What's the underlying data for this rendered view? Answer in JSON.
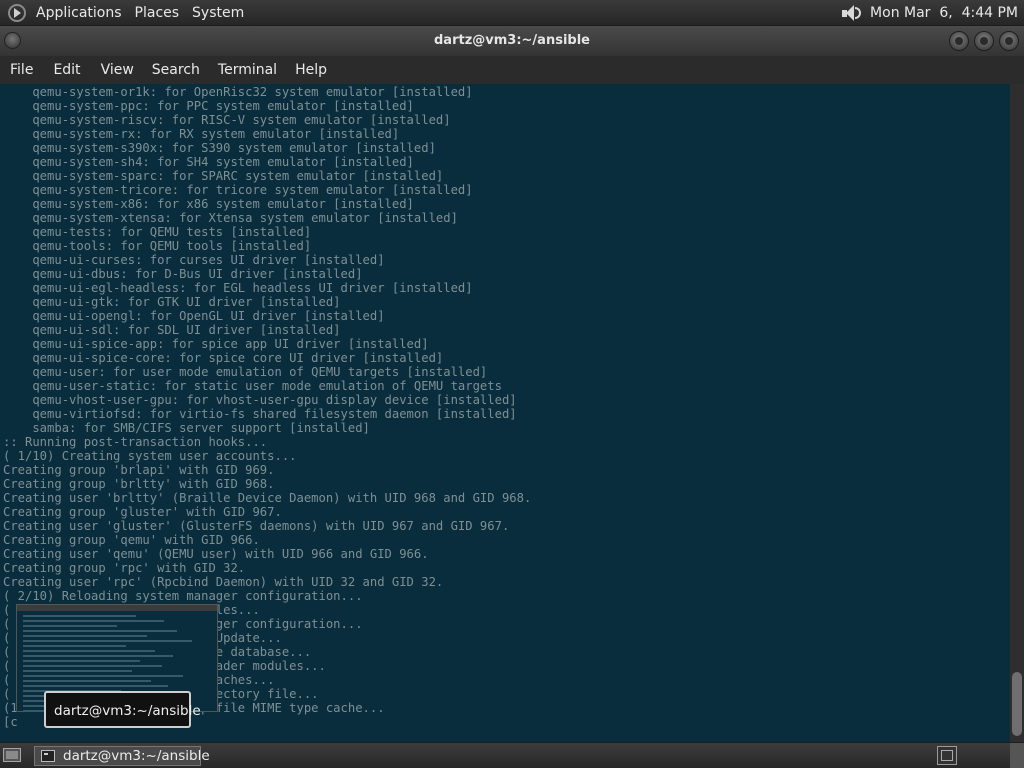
{
  "top_panel": {
    "applications": "Applications",
    "places": "Places",
    "system": "System",
    "clock": "Mon Mar  6,  4:44 PM"
  },
  "window": {
    "title": "dartz@vm3:~/ansible"
  },
  "menubar": {
    "file": "File",
    "edit": "Edit",
    "view": "View",
    "search": "Search",
    "terminal": "Terminal",
    "help": "Help"
  },
  "terminal": {
    "lines": [
      "    qemu-system-or1k: for OpenRisc32 system emulator [installed]",
      "    qemu-system-ppc: for PPC system emulator [installed]",
      "    qemu-system-riscv: for RISC-V system emulator [installed]",
      "    qemu-system-rx: for RX system emulator [installed]",
      "    qemu-system-s390x: for S390 system emulator [installed]",
      "    qemu-system-sh4: for SH4 system emulator [installed]",
      "    qemu-system-sparc: for SPARC system emulator [installed]",
      "    qemu-system-tricore: for tricore system emulator [installed]",
      "    qemu-system-x86: for x86 system emulator [installed]",
      "    qemu-system-xtensa: for Xtensa system emulator [installed]",
      "    qemu-tests: for QEMU tests [installed]",
      "    qemu-tools: for QEMU tools [installed]",
      "    qemu-ui-curses: for curses UI driver [installed]",
      "    qemu-ui-dbus: for D-Bus UI driver [installed]",
      "    qemu-ui-egl-headless: for EGL headless UI driver [installed]",
      "    qemu-ui-gtk: for GTK UI driver [installed]",
      "    qemu-ui-opengl: for OpenGL UI driver [installed]",
      "    qemu-ui-sdl: for SDL UI driver [installed]",
      "    qemu-ui-spice-app: for spice app UI driver [installed]",
      "    qemu-ui-spice-core: for spice core UI driver [installed]",
      "    qemu-user: for user mode emulation of QEMU targets [installed]",
      "    qemu-user-static: for static user mode emulation of QEMU targets",
      "    qemu-vhost-user-gpu: for vhost-user-gpu display device [installed]",
      "    qemu-virtiofsd: for virtio-fs shared filesystem daemon [installed]",
      "    samba: for SMB/CIFS server support [installed]",
      ":: Running post-transaction hooks...",
      "( 1/10) Creating system user accounts...",
      "Creating group 'brlapi' with GID 969.",
      "Creating group 'brltty' with GID 968.",
      "Creating user 'brltty' (Braille Device Daemon) with UID 968 and GID 968.",
      "Creating group 'gluster' with GID 967.",
      "Creating user 'gluster' (GlusterFS daemons) with UID 967 and GID 967.",
      "Creating group 'qemu' with GID 966.",
      "Creating user 'qemu' (QEMU user) with UID 966 and GID 966.",
      "Creating group 'rpc' with GID 32.",
      "Creating user 'rpc' (Rpcbind Daemon) with UID 32 and GID 32.",
      "( 2/10) Reloading system manager configuration...",
      "(                          files...",
      "(                          nager configuration...",
      "(                          dsUpdate...",
      "(                          ype database...",
      "(                          loader modules...",
      "(                           caches...",
      "(                          irectory file...",
      "(1                         p file MIME type cache...",
      "[c"
    ]
  },
  "taskbar": {
    "tooltip": "dartz@vm3:~/ansible",
    "task_label": "dartz@vm3:~/ansible"
  }
}
